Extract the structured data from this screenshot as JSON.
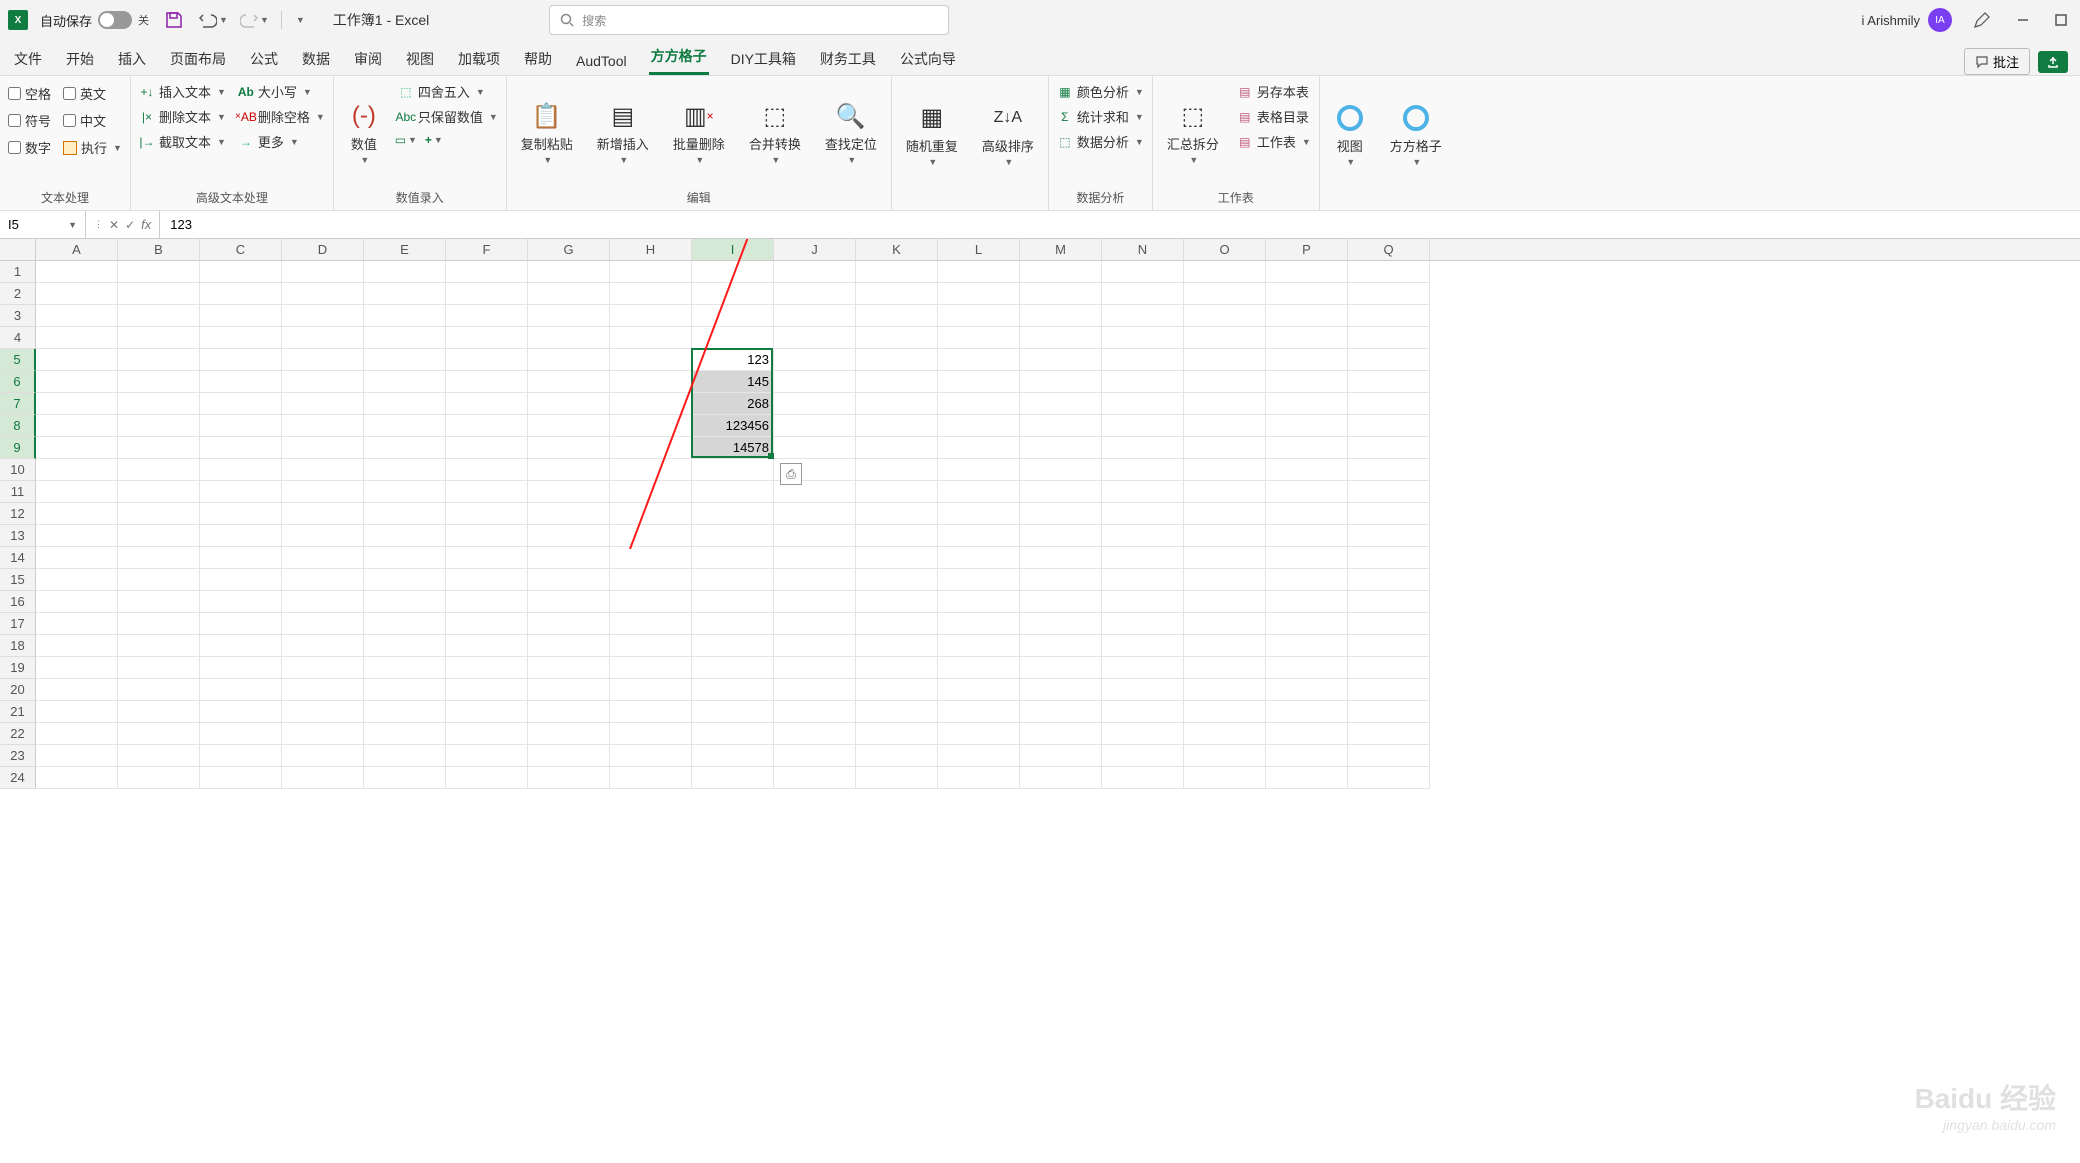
{
  "titlebar": {
    "autosave_label": "自动保存",
    "autosave_state": "关",
    "doc_title": "工作簿1 - Excel",
    "search_placeholder": "搜索",
    "user_name": "i Arishmily",
    "user_initials": "IA"
  },
  "tabs": {
    "items": [
      "文件",
      "开始",
      "插入",
      "页面布局",
      "公式",
      "数据",
      "审阅",
      "视图",
      "加载项",
      "帮助",
      "AudTool",
      "方方格子",
      "DIY工具箱",
      "财务工具",
      "公式向导"
    ],
    "active_index": 11,
    "comments_label": "批注"
  },
  "ribbon": {
    "group1": {
      "label": "文本处理",
      "checks_left": [
        "空格",
        "符号",
        "数字"
      ],
      "checks_right": [
        "英文",
        "中文"
      ],
      "execute": "执行"
    },
    "group2": {
      "label": "高级文本处理",
      "col1": [
        "插入文本",
        "删除文本",
        "截取文本"
      ],
      "col2": [
        "大小写",
        "删除空格",
        "更多"
      ]
    },
    "group3": {
      "label": "数值录入",
      "big": "数值",
      "col": [
        "四舍五入",
        "只保留数值"
      ]
    },
    "group4": {
      "label": "编辑",
      "bigs": [
        "复制粘贴",
        "新增插入",
        "批量删除",
        "合并转换",
        "查找定位"
      ]
    },
    "group5": {
      "bigs": [
        "随机重复",
        "高级排序"
      ]
    },
    "group6": {
      "label": "数据分析",
      "items": [
        "颜色分析",
        "统计求和",
        "数据分析"
      ]
    },
    "group7": {
      "label": "工作表",
      "big": "汇总拆分",
      "items": [
        "另存本表",
        "表格目录",
        "工作表"
      ]
    },
    "group8": {
      "items": [
        "视图",
        "方方格子"
      ]
    }
  },
  "formula_bar": {
    "name_box": "I5",
    "formula": "123"
  },
  "grid": {
    "columns": [
      "A",
      "B",
      "C",
      "D",
      "E",
      "F",
      "G",
      "H",
      "I",
      "J",
      "K",
      "L",
      "M",
      "N",
      "O",
      "P",
      "Q"
    ],
    "rows": 24,
    "selected_col_index": 8,
    "selected_rows": [
      5,
      6,
      7,
      8,
      9
    ],
    "cell_data": {
      "I5": "123",
      "I6": "145",
      "I7": "268",
      "I8": "123456",
      "I9": "14578"
    }
  },
  "watermark": {
    "main": "Baidu 经验",
    "sub": "jingyan.baidu.com"
  }
}
